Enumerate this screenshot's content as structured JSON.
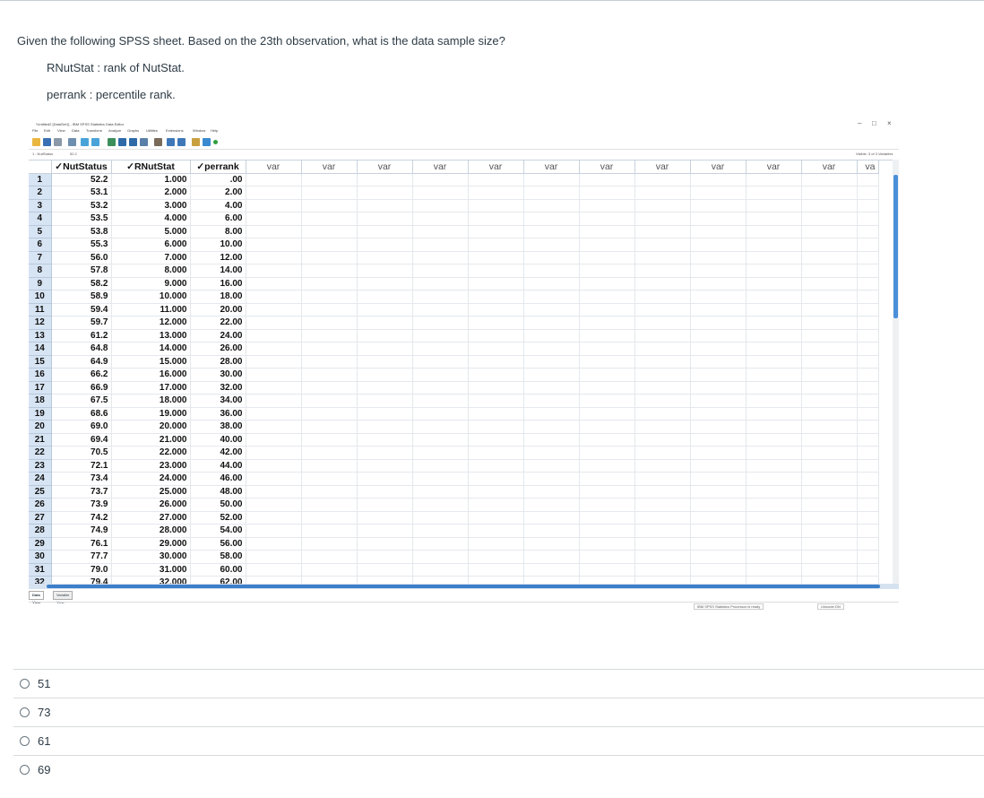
{
  "question": {
    "text": "Given the following SPSS sheet. Based on the 23th observation, what is the data sample size?",
    "definitions": [
      "RNutStat : rank of NutStat.",
      "perrank : percentile rank."
    ]
  },
  "spss": {
    "window_title": "*Untitled2 [DataSet1] - IBM SPSS Statistics Data Editor",
    "window_controls": [
      "–",
      "□",
      "×"
    ],
    "menu": [
      "File",
      "Edit",
      "View",
      "Data",
      "Transform",
      "Analyze",
      "Graphs",
      "Utilities",
      "Extensions",
      "Window",
      "Help"
    ],
    "cell_ref": "1 : NutStatus",
    "cell_value": "52.2",
    "visible_label": "Visible: 3 of 3 Variables",
    "columns": [
      "NutStatus",
      "RNutStat",
      "perrank"
    ],
    "var_label": "var",
    "var_truncated": "va",
    "rows": [
      [
        "1",
        "52.2",
        "1.000",
        ".00"
      ],
      [
        "2",
        "53.1",
        "2.000",
        "2.00"
      ],
      [
        "3",
        "53.2",
        "3.000",
        "4.00"
      ],
      [
        "4",
        "53.5",
        "4.000",
        "6.00"
      ],
      [
        "5",
        "53.8",
        "5.000",
        "8.00"
      ],
      [
        "6",
        "55.3",
        "6.000",
        "10.00"
      ],
      [
        "7",
        "56.0",
        "7.000",
        "12.00"
      ],
      [
        "8",
        "57.8",
        "8.000",
        "14.00"
      ],
      [
        "9",
        "58.2",
        "9.000",
        "16.00"
      ],
      [
        "10",
        "58.9",
        "10.000",
        "18.00"
      ],
      [
        "11",
        "59.4",
        "11.000",
        "20.00"
      ],
      [
        "12",
        "59.7",
        "12.000",
        "22.00"
      ],
      [
        "13",
        "61.2",
        "13.000",
        "24.00"
      ],
      [
        "14",
        "64.8",
        "14.000",
        "26.00"
      ],
      [
        "15",
        "64.9",
        "15.000",
        "28.00"
      ],
      [
        "16",
        "66.2",
        "16.000",
        "30.00"
      ],
      [
        "17",
        "66.9",
        "17.000",
        "32.00"
      ],
      [
        "18",
        "67.5",
        "18.000",
        "34.00"
      ],
      [
        "19",
        "68.6",
        "19.000",
        "36.00"
      ],
      [
        "20",
        "69.0",
        "20.000",
        "38.00"
      ],
      [
        "21",
        "69.4",
        "21.000",
        "40.00"
      ],
      [
        "22",
        "70.5",
        "22.000",
        "42.00"
      ],
      [
        "23",
        "72.1",
        "23.000",
        "44.00"
      ],
      [
        "24",
        "73.4",
        "24.000",
        "46.00"
      ],
      [
        "25",
        "73.7",
        "25.000",
        "48.00"
      ],
      [
        "26",
        "73.9",
        "26.000",
        "50.00"
      ],
      [
        "27",
        "74.2",
        "27.000",
        "52.00"
      ],
      [
        "28",
        "74.9",
        "28.000",
        "54.00"
      ],
      [
        "29",
        "76.1",
        "29.000",
        "56.00"
      ],
      [
        "30",
        "77.7",
        "30.000",
        "58.00"
      ],
      [
        "31",
        "79.0",
        "31.000",
        "60.00"
      ],
      [
        "32",
        "79.4",
        "32.000",
        "62.00"
      ]
    ],
    "tabs": [
      "Data View",
      "Variable View"
    ],
    "status": [
      "IBM SPSS Statistics Processor is ready",
      "Unicode:ON"
    ]
  },
  "options": [
    "51",
    "73",
    "61",
    "69"
  ]
}
